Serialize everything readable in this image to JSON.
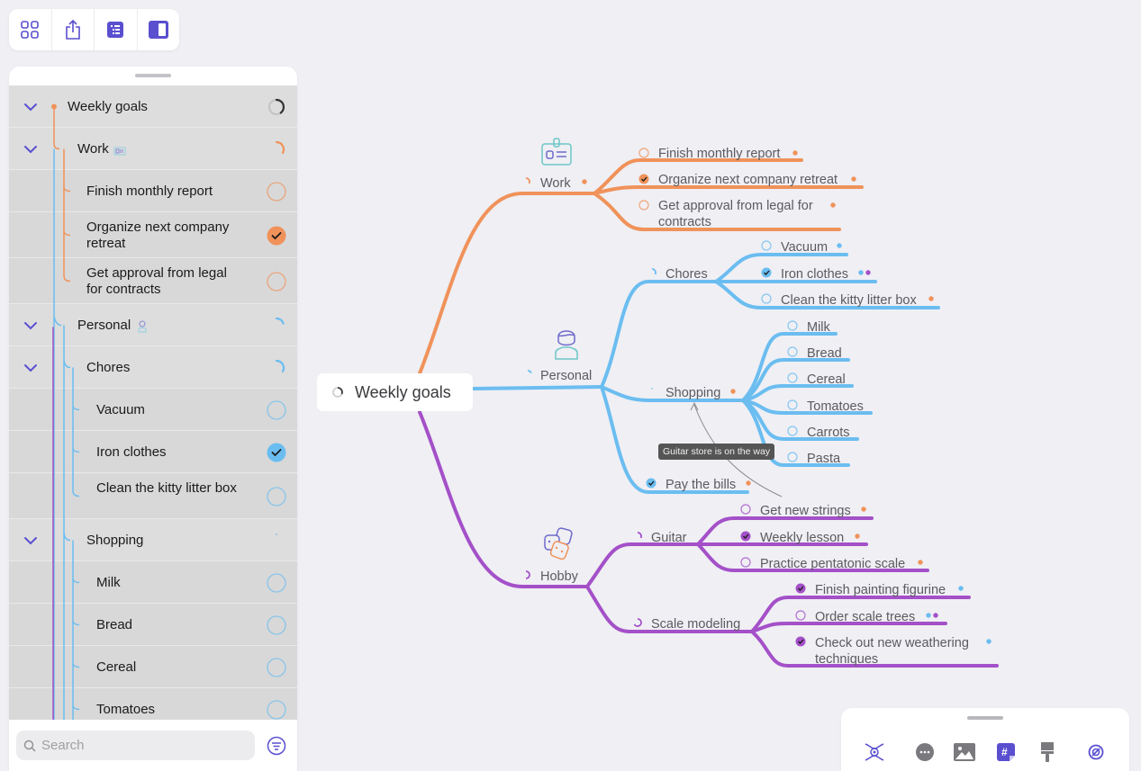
{
  "colors": {
    "accent": "#5a4fcf",
    "work": "#f0925a",
    "personal": "#6bbdf0",
    "hobby": "#a450c8",
    "canvas_bg": "#efeff4"
  },
  "top_toolbar": {
    "buttons": [
      {
        "name": "grid-view",
        "icon": "grid-icon"
      },
      {
        "name": "share",
        "icon": "share-icon"
      },
      {
        "name": "outline-view",
        "icon": "outline-list-icon"
      },
      {
        "name": "sidebar-toggle",
        "icon": "sidebar-icon"
      }
    ]
  },
  "outline": {
    "rows": [
      {
        "label": "Weekly goals",
        "level": 0,
        "collapsible": true,
        "status": "progress",
        "progress": 0.4,
        "branch": "root"
      },
      {
        "label": "Work",
        "level": 1,
        "collapsible": true,
        "status": "progress",
        "progress": 0.33,
        "branch": "work",
        "icon": "id-badge-icon"
      },
      {
        "label": "Finish monthly report",
        "level": 2,
        "collapsible": false,
        "status": "unchecked",
        "branch": "work"
      },
      {
        "label": "Organize next company retreat",
        "level": 2,
        "collapsible": false,
        "status": "checked",
        "branch": "work"
      },
      {
        "label": "Get approval from legal for contracts",
        "level": 2,
        "collapsible": false,
        "status": "unchecked",
        "branch": "work"
      },
      {
        "label": "Personal",
        "level": 1,
        "collapsible": true,
        "status": "progress",
        "progress": 0.2,
        "branch": "personal",
        "icon": "person-icon"
      },
      {
        "label": "Chores",
        "level": 2,
        "collapsible": true,
        "status": "progress",
        "progress": 0.33,
        "branch": "personal"
      },
      {
        "label": "Vacuum",
        "level": 3,
        "collapsible": false,
        "status": "unchecked",
        "branch": "personal"
      },
      {
        "label": "Iron clothes",
        "level": 3,
        "collapsible": false,
        "status": "checked",
        "branch": "personal"
      },
      {
        "label": "Clean the kitty litter box",
        "level": 3,
        "collapsible": false,
        "status": "unchecked",
        "branch": "personal"
      },
      {
        "label": "Shopping",
        "level": 2,
        "collapsible": true,
        "status": "progress",
        "progress": 0.0,
        "branch": "personal"
      },
      {
        "label": "Milk",
        "level": 3,
        "collapsible": false,
        "status": "unchecked",
        "branch": "personal"
      },
      {
        "label": "Bread",
        "level": 3,
        "collapsible": false,
        "status": "unchecked",
        "branch": "personal"
      },
      {
        "label": "Cereal",
        "level": 3,
        "collapsible": false,
        "status": "unchecked",
        "branch": "personal"
      },
      {
        "label": "Tomatoes",
        "level": 3,
        "collapsible": false,
        "status": "unchecked",
        "branch": "personal"
      }
    ],
    "search_placeholder": "Search"
  },
  "mindmap": {
    "root": {
      "label": "Weekly goals",
      "progress": 0.4
    },
    "branches": [
      {
        "label": "Work",
        "color": "work",
        "icon": "id-badge-icon",
        "progress": 0.33,
        "tags": [
          "orange"
        ],
        "children": [
          {
            "label": "Finish monthly report",
            "checked": false,
            "tags": [
              "orange"
            ]
          },
          {
            "label": "Organize next company retreat",
            "checked": true,
            "tags": [
              "orange"
            ]
          },
          {
            "label": "Get approval from legal for contracts",
            "label_lines": [
              "Get approval from legal for",
              "contracts"
            ],
            "checked": false,
            "tags": [
              "orange"
            ]
          }
        ]
      },
      {
        "label": "Personal",
        "color": "personal",
        "icon": "person-icon",
        "progress": 0.2,
        "tags": [],
        "children": [
          {
            "label": "Chores",
            "progress": 0.33,
            "children": [
              {
                "label": "Vacuum",
                "checked": false,
                "tags": [
                  "blue"
                ]
              },
              {
                "label": "Iron clothes",
                "checked": true,
                "tags": [
                  "blue",
                  "purple"
                ]
              },
              {
                "label": "Clean the kitty litter box",
                "checked": false,
                "tags": [
                  "orange"
                ]
              }
            ]
          },
          {
            "label": "Shopping",
            "progress": 0.0,
            "tags": [
              "orange"
            ],
            "children": [
              {
                "label": "Milk",
                "checked": false
              },
              {
                "label": "Bread",
                "checked": false
              },
              {
                "label": "Cereal",
                "checked": false
              },
              {
                "label": "Tomatoes",
                "checked": false
              },
              {
                "label": "Carrots",
                "checked": false
              },
              {
                "label": "Pasta",
                "checked": false
              }
            ]
          },
          {
            "label": "Pay the bills",
            "checked": true,
            "tags": [
              "orange"
            ]
          }
        ]
      },
      {
        "label": "Hobby",
        "color": "hobby",
        "icon": "dice-icon",
        "progress": 0.5,
        "tags": [],
        "children": [
          {
            "label": "Guitar",
            "progress": 0.33,
            "children": [
              {
                "label": "Get new strings",
                "checked": false,
                "tags": [
                  "orange"
                ]
              },
              {
                "label": "Weekly lesson",
                "checked": true,
                "tags": [
                  "orange"
                ]
              },
              {
                "label": "Practice pentatonic scale",
                "checked": false,
                "tags": [
                  "orange"
                ]
              }
            ]
          },
          {
            "label": "Scale modeling",
            "progress": 0.67,
            "children": [
              {
                "label": "Finish painting figurine",
                "checked": true,
                "tags": [
                  "blue"
                ]
              },
              {
                "label": "Order scale trees",
                "checked": false,
                "tags": [
                  "blue",
                  "purple"
                ]
              },
              {
                "label": "Check out new weathering techniques",
                "label_lines": [
                  "Check out new weathering",
                  "techniques"
                ],
                "checked": true,
                "tags": [
                  "blue"
                ]
              }
            ]
          }
        ]
      }
    ],
    "relationship_note": "Guitar store is on the way"
  },
  "bottom_toolbar": {
    "buttons": [
      {
        "name": "focus",
        "icon": "focus-node-icon"
      },
      {
        "name": "more",
        "icon": "more-icon"
      },
      {
        "name": "image",
        "icon": "image-icon"
      },
      {
        "name": "tag",
        "icon": "hashtag-note-icon"
      },
      {
        "name": "style",
        "icon": "paintbrush-icon"
      },
      {
        "name": "sticker",
        "icon": "sticker-icon"
      }
    ]
  }
}
